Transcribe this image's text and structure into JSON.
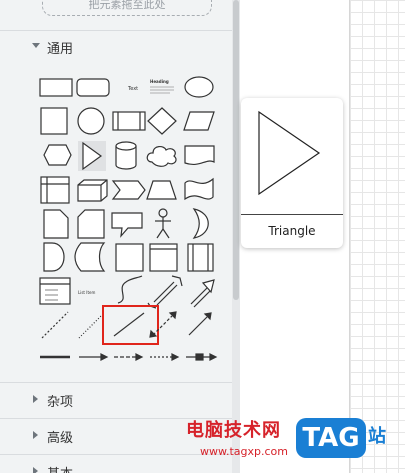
{
  "sidebar": {
    "dropzone_text": "把元素拖至此处",
    "sections": [
      {
        "label": "通用",
        "expanded": true
      },
      {
        "label": "杂项",
        "expanded": false
      },
      {
        "label": "高级",
        "expanded": false
      },
      {
        "label": "基本",
        "expanded": false
      }
    ],
    "shape_text": {
      "text": "Text",
      "heading": "Heading",
      "list_item": "List Item"
    },
    "selected_shape": "Line"
  },
  "tooltip": {
    "shape_name": "Triangle"
  },
  "watermark": {
    "text": "电脑技术网",
    "url": "www.tagxp.com",
    "badge": "TAG",
    "suffix": "站"
  },
  "colors": {
    "selection": "#e0251b",
    "stroke": "#333333",
    "sidebar_bg": "#f1f3f4"
  }
}
